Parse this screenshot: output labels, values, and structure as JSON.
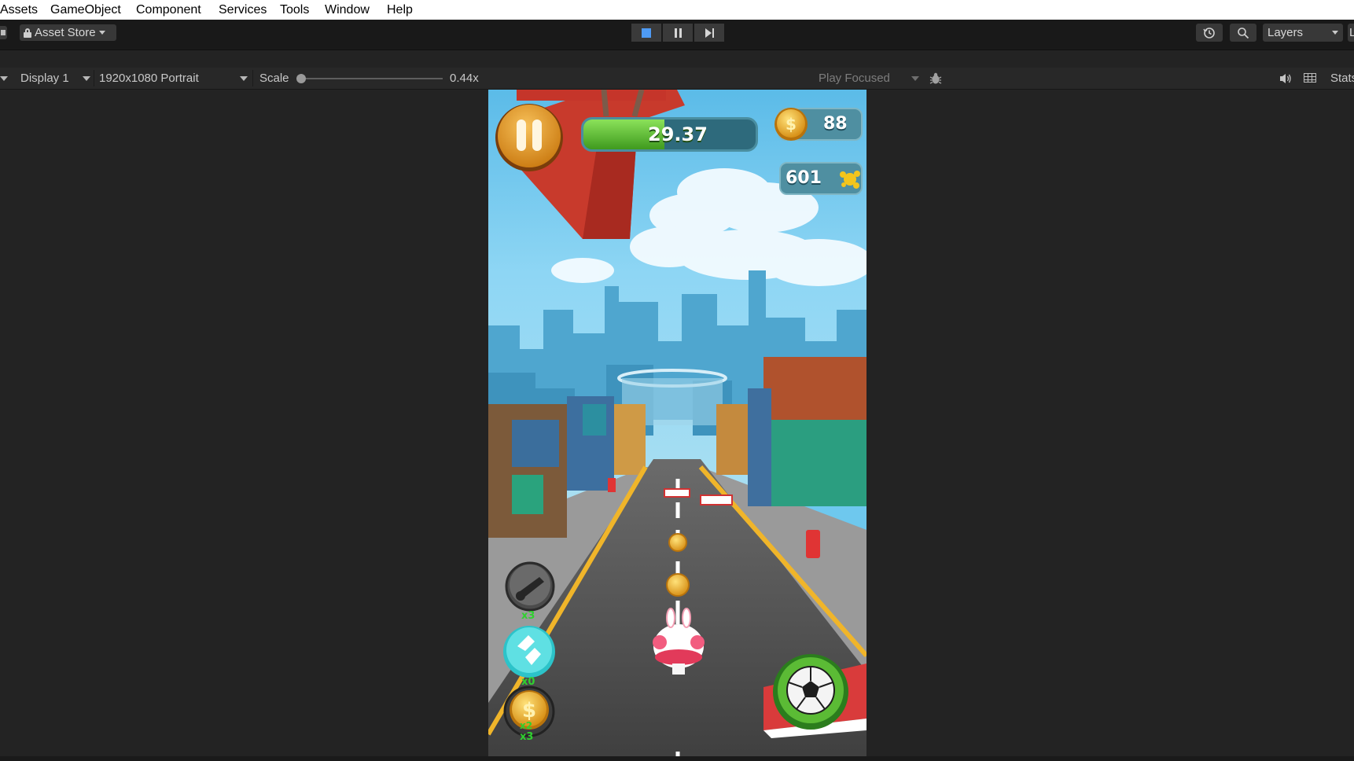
{
  "menu": {
    "items": [
      "Assets",
      "GameObject",
      "Component",
      "Services",
      "Tools",
      "Window",
      "Help"
    ]
  },
  "toolbar": {
    "asset_store_label": "Asset Store",
    "layers_label": "Layers",
    "right_stub_label": "L",
    "play_icon": "stop-icon",
    "pause_icon": "pause-icon",
    "step_icon": "step-icon"
  },
  "game_view": {
    "display_label": "Display 1",
    "resolution_label": "1920x1080 Portrait",
    "scale_label": "Scale",
    "scale_value": "0.44x",
    "scale_level": 0.0,
    "play_mode_label": "Play Focused",
    "stats_label": "Stats"
  },
  "hud": {
    "timer_value": "29.37",
    "timer_fill": 0.37,
    "coins_value": "88",
    "score_value": "601",
    "powerup_cannon_count": "x3",
    "powerup_magnet_count": "x0",
    "powerup_coin_count": "x3",
    "powerup_coin_multiplier": "x2"
  },
  "colors": {
    "accent_blue": "#4e9bf5",
    "editor_bg": "#232323",
    "toolbar_bg": "#191919",
    "hud_orange": "#f0a32a",
    "timer_green": "#5bc234",
    "count_green": "#2fd12f"
  }
}
